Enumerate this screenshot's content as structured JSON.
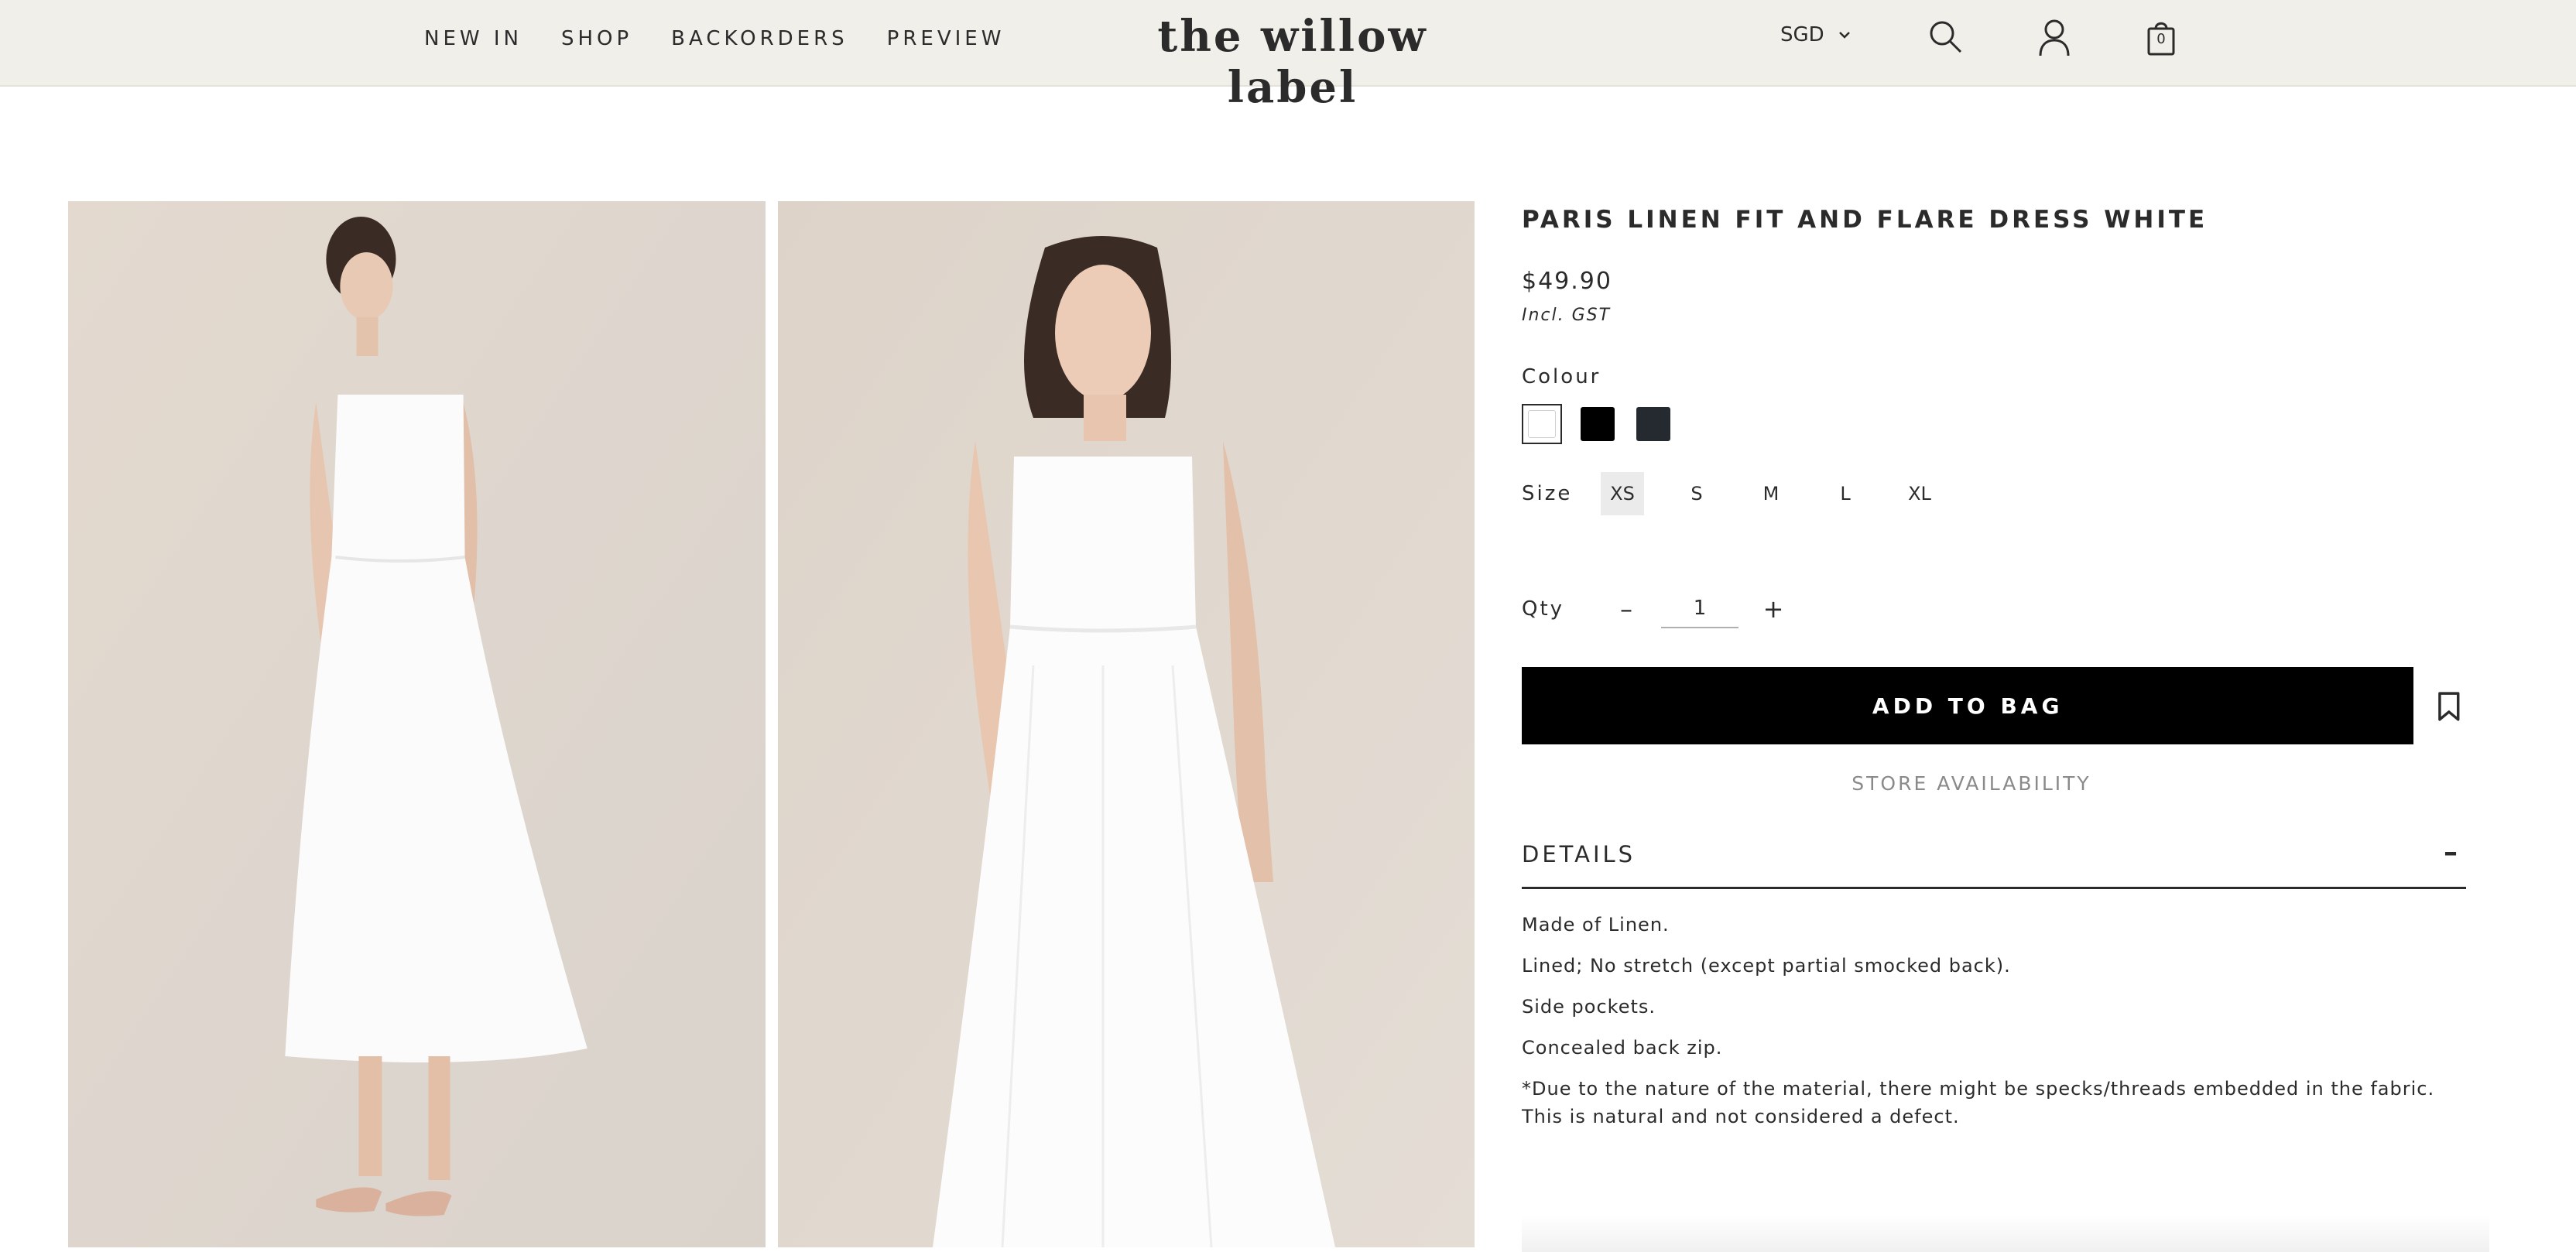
{
  "header": {
    "nav": [
      "NEW IN",
      "SHOP",
      "BACKORDERS",
      "PREVIEW"
    ],
    "logo": "the willow label",
    "currency": "SGD",
    "bag_count": "0"
  },
  "product": {
    "title": "PARIS LINEN FIT AND FLARE DRESS WHITE",
    "price": "$49.90",
    "tax_note": "Incl. GST",
    "colour_label": "Colour",
    "colours": [
      "#ffffff",
      "#000000",
      "#252a30"
    ],
    "size_label": "Size",
    "sizes": [
      "XS",
      "S",
      "M",
      "L",
      "XL"
    ],
    "selected_size": "XS",
    "qty_label": "Qty",
    "qty_value": "1",
    "qty_minus": "–",
    "qty_plus": "+",
    "add_to_bag": "ADD TO BAG",
    "store_availability": "STORE AVAILABILITY"
  },
  "details": {
    "heading": "DETAILS",
    "toggle": "–",
    "lines": [
      "Made of Linen.",
      "Lined; No stretch (except partial smocked back).",
      "Side pockets.",
      "Concealed back zip.",
      "*Due to the nature of the material, there might be specks/threads embedded in the fabric. This is natural and not considered a defect."
    ]
  }
}
